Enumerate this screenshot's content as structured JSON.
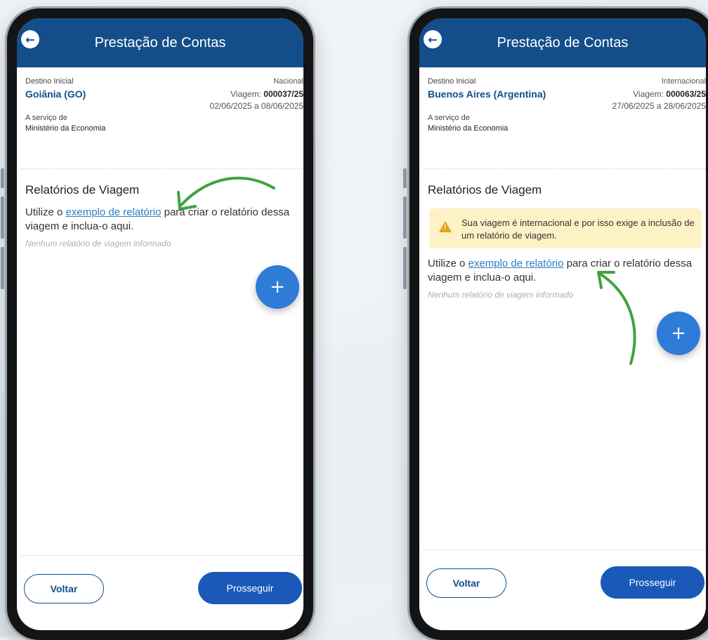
{
  "phones": [
    {
      "title": "Prestação de Contas",
      "destination_label": "Destino Inicial",
      "destination": "Goiânia (GO)",
      "trip_type": "Nacional",
      "trip_label": "Viagem:",
      "trip_number": "000037/25",
      "dates": "02/06/2025 a 08/06/2025",
      "service_label": "A serviço de",
      "service": "Ministério da Economia",
      "section_title": "Relatórios de Viagem",
      "hint_before": "Utilize o ",
      "hint_link": "exemplo de relatório",
      "hint_after": " para criar o relatório dessa viagem e inclua-o aqui.",
      "empty_text": "Nenhum relatório de viagem informado",
      "fab_label": "+",
      "back_label": "Voltar",
      "next_label": "Prosseguir"
    },
    {
      "title": "Prestação de Contas",
      "destination_label": "Destino Inicial",
      "destination": "Buenos Aires (Argentina)",
      "trip_type": "Internacional",
      "trip_label": "Viagem:",
      "trip_number": "000063/25",
      "dates": "27/06/2025 a 28/06/2025",
      "service_label": "A serviço de",
      "service": "Ministério da Economia",
      "section_title": "Relatórios de Viagem",
      "warning": "Sua viagem é internacional e por isso exige a inclusão de um relatório de viagem.",
      "hint_before": "Utilize o ",
      "hint_link": "exemplo de relatório",
      "hint_after": " para criar o relatório dessa viagem e inclua-o aqui.",
      "empty_text": "Nenhum relatório de viagem informado",
      "fab_label": "+",
      "back_label": "Voltar",
      "next_label": "Prosseguir"
    }
  ],
  "colors": {
    "appbar": "#134e8a",
    "link": "#2b7fc4",
    "fab": "#2e7bd8",
    "primary_button": "#1a59b8",
    "warning_bg": "#fdf2c6",
    "annotation_arrow": "#3fa33f"
  },
  "icons": {
    "back": "arrow-left-circle-icon",
    "warning": "warning-triangle-icon",
    "fab": "plus-icon"
  }
}
